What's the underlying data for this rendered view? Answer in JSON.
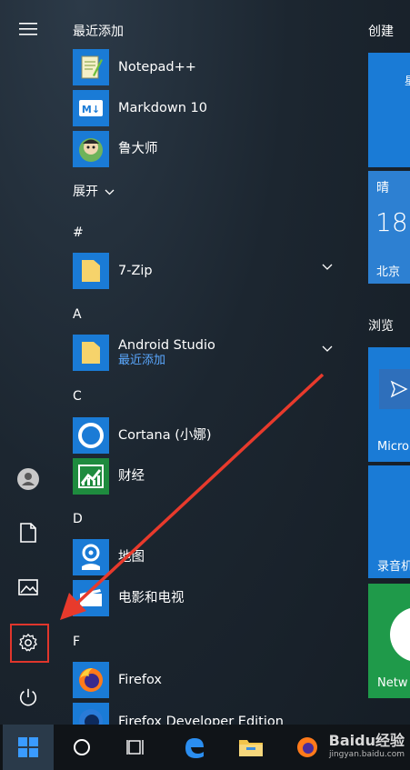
{
  "rail": {
    "icons": [
      "hamburger-menu-icon",
      "user-avatar-icon",
      "document-icon",
      "picture-icon",
      "gear-icon",
      "power-icon"
    ]
  },
  "list": {
    "recent_header": "最近添加",
    "recent": [
      {
        "label": "Notepad++",
        "icon": "notepadpp-icon"
      },
      {
        "label": "Markdown 10",
        "icon": "markdown-icon"
      },
      {
        "label": "鲁大师",
        "icon": "ludashi-icon"
      }
    ],
    "expand_label": "展开",
    "sections": [
      {
        "letter": "#",
        "items": [
          {
            "label": "7-Zip",
            "icon": "folder-icon",
            "sub": "",
            "expand": true
          }
        ]
      },
      {
        "letter": "A",
        "items": [
          {
            "label": "Android Studio",
            "icon": "folder-icon",
            "sub": "最近添加",
            "expand": true
          }
        ]
      },
      {
        "letter": "C",
        "items": [
          {
            "label": "Cortana (小娜)",
            "icon": "cortana-icon",
            "sub": ""
          },
          {
            "label": "财经",
            "icon": "finance-icon",
            "sub": ""
          }
        ]
      },
      {
        "letter": "D",
        "items": [
          {
            "label": "地图",
            "icon": "maps-icon",
            "sub": ""
          },
          {
            "label": "电影和电视",
            "icon": "movies-icon",
            "sub": ""
          }
        ]
      },
      {
        "letter": "F",
        "items": [
          {
            "label": "Firefox",
            "icon": "firefox-icon",
            "sub": ""
          },
          {
            "label": "Firefox Developer Edition",
            "icon": "firefox-dev-icon",
            "sub": ""
          }
        ]
      }
    ]
  },
  "tiles": {
    "create_header": "创建",
    "weather_condition": "晴",
    "weather_temp": "18°",
    "weather_city": "北京",
    "browse_header": "浏览",
    "tile_micro": "Micro",
    "tile_recorder": "录音机",
    "tile_network": "Netw"
  },
  "taskbar": {
    "icons": [
      "windows-start-icon",
      "cortana-circle-icon",
      "task-view-icon",
      "edge-icon",
      "file-explorer-icon",
      "firefox-icon"
    ]
  },
  "watermark": {
    "text": "Baidu经验",
    "sub": "jingyan.baidu.com"
  },
  "colors": {
    "accent": "#1a7bd6",
    "highlight": "#e0362c",
    "link": "#5aa8ff"
  }
}
